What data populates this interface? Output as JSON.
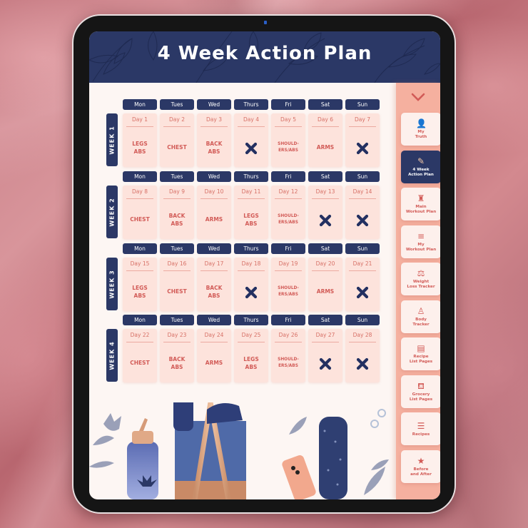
{
  "header": {
    "title": "4 Week Action Plan"
  },
  "colors": {
    "navy": "#2b3866",
    "coral": "#d25b57",
    "cell_bg": "#fde3dc",
    "sidebar_bg": "#f5b09f"
  },
  "day_headers": [
    "Mon",
    "Tues",
    "Wed",
    "Thurs",
    "Fri",
    "Sat",
    "Sun"
  ],
  "weeks": [
    {
      "label": "WEEK 1",
      "days": [
        {
          "day": "Day 1",
          "workout": "LEGS\nABS"
        },
        {
          "day": "Day 2",
          "workout": "CHEST"
        },
        {
          "day": "Day 3",
          "workout": "BACK\nABS"
        },
        {
          "day": "Day 4",
          "workout": "rest-x"
        },
        {
          "day": "Day 5",
          "workout": "SHOULD-\nERS/ABS"
        },
        {
          "day": "Day 6",
          "workout": "ARMS"
        },
        {
          "day": "Day 7",
          "workout": "rest-x"
        }
      ]
    },
    {
      "label": "WEEK 2",
      "days": [
        {
          "day": "Day 8",
          "workout": "CHEST"
        },
        {
          "day": "Day 9",
          "workout": "BACK\nABS"
        },
        {
          "day": "Day 10",
          "workout": "ARMS"
        },
        {
          "day": "Day 11",
          "workout": "LEGS\nABS"
        },
        {
          "day": "Day 12",
          "workout": "SHOULD-\nERS/ABS"
        },
        {
          "day": "Day 13",
          "workout": "rest-x"
        },
        {
          "day": "Day 14",
          "workout": "rest-x"
        }
      ]
    },
    {
      "label": "WEEK 3",
      "days": [
        {
          "day": "Day 15",
          "workout": "LEGS\nABS"
        },
        {
          "day": "Day 16",
          "workout": "CHEST"
        },
        {
          "day": "Day 17",
          "workout": "BACK\nABS"
        },
        {
          "day": "Day 18",
          "workout": "rest-x"
        },
        {
          "day": "Day 19",
          "workout": "SHOULD-\nERS/ABS"
        },
        {
          "day": "Day 20",
          "workout": "ARMS"
        },
        {
          "day": "Day 21",
          "workout": "rest-x"
        }
      ]
    },
    {
      "label": "WEEK 4",
      "days": [
        {
          "day": "Day 22",
          "workout": "CHEST"
        },
        {
          "day": "Day 23",
          "workout": "BACK\nABS"
        },
        {
          "day": "Day 24",
          "workout": "ARMS"
        },
        {
          "day": "Day 25",
          "workout": "LEGS\nABS"
        },
        {
          "day": "Day 26",
          "workout": "SHOULD-\nERS/ABS"
        },
        {
          "day": "Day 27",
          "workout": "rest-x"
        },
        {
          "day": "Day 28",
          "workout": "rest-x"
        }
      ]
    }
  ],
  "sidebar": {
    "collapse_icon": "chevron-down-icon",
    "items": [
      {
        "label": "My\nTruth",
        "icon": "person-icon",
        "glyph": "👤",
        "active": false
      },
      {
        "label": "4 Week\nAction Plan",
        "icon": "notepad-pen-icon",
        "glyph": "✎",
        "active": true
      },
      {
        "label": "Main\nWorkout Plan",
        "icon": "workout-outfit-icon",
        "glyph": "♜",
        "active": false
      },
      {
        "label": "My\nWorkout Plan",
        "icon": "menu-lines-icon",
        "glyph": "≡",
        "active": false
      },
      {
        "label": "Weight\nLoss Tracker",
        "icon": "scale-icon",
        "glyph": "⚖",
        "active": false
      },
      {
        "label": "Body\nTracker",
        "icon": "body-icon",
        "glyph": "♙",
        "active": false
      },
      {
        "label": "Recipe\nList Pages",
        "icon": "recipe-book-icon",
        "glyph": "▤",
        "active": false
      },
      {
        "label": "Grocery\nList Pages",
        "icon": "grocery-basket-icon",
        "glyph": "⛾",
        "active": false
      },
      {
        "label": "Recipes",
        "icon": "list-icon",
        "glyph": "☰",
        "active": false
      },
      {
        "label": "Before\nand After",
        "icon": "star-icon",
        "glyph": "★",
        "active": false
      }
    ]
  }
}
